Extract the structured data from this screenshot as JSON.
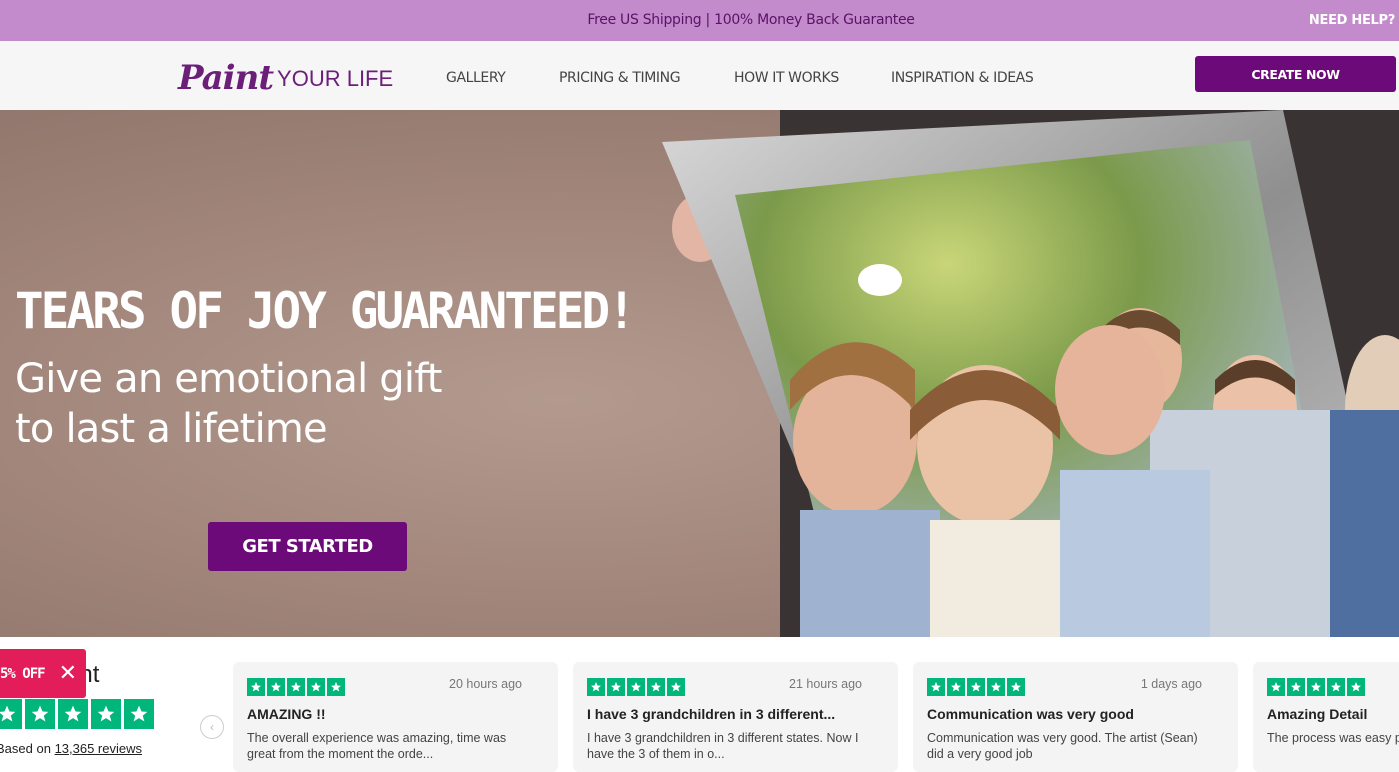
{
  "topbar": {
    "promo": "Free US Shipping | 100% Money Back Guarantee",
    "help": "NEED HELP?"
  },
  "nav": {
    "logo_script": "Paint",
    "logo_plain": "YOUR LIFE",
    "links": [
      "GALLERY",
      "PRICING & TIMING",
      "HOW IT WORKS",
      "INSPIRATION & IDEAS"
    ],
    "cta": "CREATE NOW"
  },
  "hero": {
    "title": "TEARS OF JOY GUARANTEED!",
    "sub_line1": "Give an emotional gift",
    "sub_line2": "to last a lifetime",
    "button": "GET STARTED"
  },
  "reviews": {
    "summary_partial": "ent",
    "based_on_prefix": "Based on",
    "based_on_count": "13,365 reviews",
    "discount": "5% OFF",
    "cards": [
      {
        "time": "20 hours ago",
        "title": "AMAZING !!",
        "body": "The overall experience was amazing, time was great from the moment the orde..."
      },
      {
        "time": "21 hours ago",
        "title": "I have 3 grandchildren in 3 different...",
        "body": "I have 3 grandchildren in 3 different states. Now I have the 3 of them in o..."
      },
      {
        "time": "1 days ago",
        "title": "Communication was very good",
        "body": "Communication was very good. The artist (Sean) did a very good job"
      },
      {
        "time": "",
        "title": "Amazing Detail",
        "body": "The process was easy painting too. I LOVE th"
      }
    ]
  },
  "colors": {
    "topbar": "#c38bcb",
    "brand_purple": "#6b0a78",
    "trustpilot_green": "#00b67a",
    "discount_red": "#e31c5a"
  },
  "icons": {
    "star": "star-icon",
    "close": "close-icon",
    "prev": "chevron-left-icon"
  }
}
